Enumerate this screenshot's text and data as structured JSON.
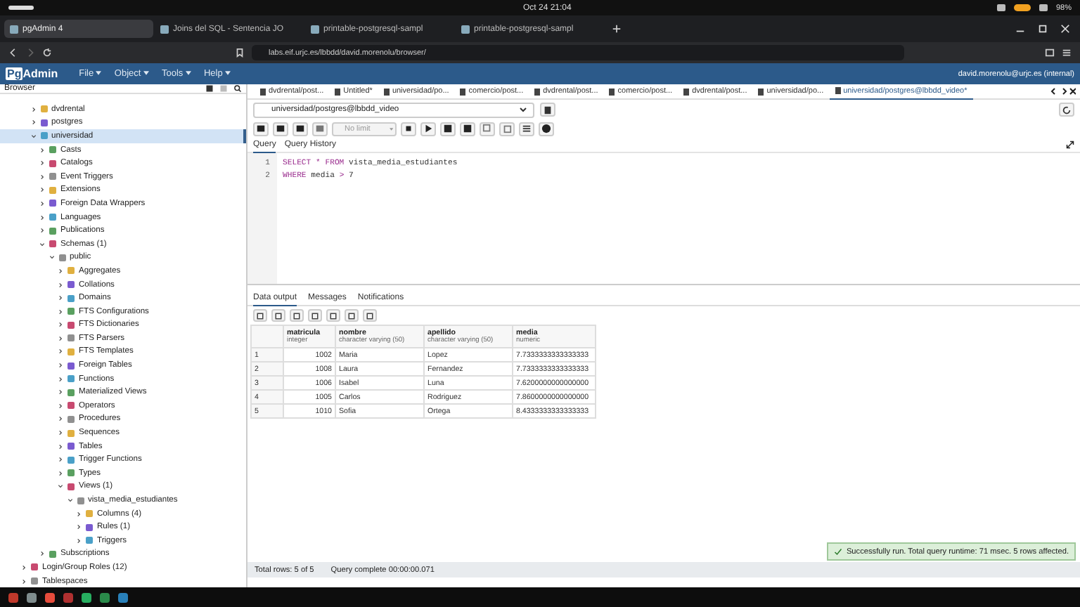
{
  "system_bar": {
    "date": "Oct 24",
    "time": "21:04",
    "battery": "98%"
  },
  "browser_tabs": [
    {
      "title": "pgAdmin 4",
      "selected": true
    },
    {
      "title": "Joins del SQL - Sentencia JO",
      "selected": false
    },
    {
      "title": "printable-postgresql-sampl",
      "selected": false
    },
    {
      "title": "printable-postgresql-sampl",
      "selected": false
    }
  ],
  "address_bar": {
    "url": "labs.eif.urjc.es/lbbdd/david.morenolu/browser/"
  },
  "pgadmin": {
    "logo_box": "Pg",
    "logo_text": "Admin",
    "menus": [
      "File",
      "Object",
      "Tools",
      "Help"
    ],
    "user": "david.morenolu@urjc.es (internal)"
  },
  "browser_panel": {
    "title": "Browser"
  },
  "tree": {
    "items": [
      {
        "children": [
          {
            "label": "dvdrental",
            "expanded": false,
            "selected": false
          },
          {
            "label": "postgres",
            "expanded": false,
            "selected": false
          },
          {
            "label": "universidad",
            "expanded": true,
            "selected": true,
            "children": [
              {
                "label": "Casts",
                "expanded": false,
                "selected": false
              },
              {
                "label": "Catalogs",
                "expanded": false,
                "selected": false
              },
              {
                "label": "Event Triggers",
                "expanded": false,
                "selected": false
              },
              {
                "label": "Extensions",
                "expanded": false,
                "selected": false
              },
              {
                "label": "Foreign Data Wrappers",
                "expanded": false,
                "selected": false
              },
              {
                "label": "Languages",
                "expanded": false,
                "selected": false
              },
              {
                "label": "Publications",
                "expanded": false,
                "selected": false
              },
              {
                "label": "Schemas (1)",
                "expanded": true,
                "selected": false,
                "children": [
                  {
                    "label": "public",
                    "expanded": true,
                    "selected": false,
                    "children": [
                      {
                        "label": "Aggregates",
                        "expanded": false,
                        "selected": false
                      },
                      {
                        "label": "Collations",
                        "expanded": false,
                        "selected": false
                      },
                      {
                        "label": "Domains",
                        "expanded": false,
                        "selected": false
                      },
                      {
                        "label": "FTS Configurations",
                        "expanded": false,
                        "selected": false
                      },
                      {
                        "label": "FTS Dictionaries",
                        "expanded": false,
                        "selected": false
                      },
                      {
                        "label": "FTS Parsers",
                        "expanded": false,
                        "selected": false
                      },
                      {
                        "label": "FTS Templates",
                        "expanded": false,
                        "selected": false
                      },
                      {
                        "label": "Foreign Tables",
                        "expanded": false,
                        "selected": false
                      },
                      {
                        "label": "Functions",
                        "expanded": false,
                        "selected": false
                      },
                      {
                        "label": "Materialized Views",
                        "expanded": false,
                        "selected": false
                      },
                      {
                        "label": "Operators",
                        "expanded": false,
                        "selected": false
                      },
                      {
                        "label": "Procedures",
                        "expanded": false,
                        "selected": false
                      },
                      {
                        "label": "Sequences",
                        "expanded": false,
                        "selected": false
                      },
                      {
                        "label": "Tables",
                        "expanded": false,
                        "selected": false
                      },
                      {
                        "label": "Trigger Functions",
                        "expanded": false,
                        "selected": false
                      },
                      {
                        "label": "Types",
                        "expanded": false,
                        "selected": false
                      },
                      {
                        "label": "Views (1)",
                        "expanded": true,
                        "selected": false,
                        "children": [
                          {
                            "label": "vista_media_estudiantes",
                            "expanded": true,
                            "selected": false,
                            "children": [
                              {
                                "label": "Columns (4)",
                                "expanded": false,
                                "selected": false
                              },
                              {
                                "label": "Rules (1)",
                                "expanded": false,
                                "selected": false
                              },
                              {
                                "label": "Triggers",
                                "expanded": false,
                                "selected": false
                              }
                            ]
                          }
                        ]
                      }
                    ]
                  }
                ]
              },
              {
                "label": "Subscriptions",
                "expanded": false,
                "selected": false
              }
            ]
          }
        ]
      },
      {
        "label": "Login/Group Roles (12)",
        "expanded": false,
        "selected": false
      },
      {
        "label": "Tablespaces",
        "expanded": false,
        "selected": false
      }
    ]
  },
  "query_tabs": [
    {
      "title": "dvdrental/post...",
      "selected": false
    },
    {
      "title": "Untitled*",
      "selected": false
    },
    {
      "title": "universidad/po...",
      "selected": false
    },
    {
      "title": "comercio/post...",
      "selected": false
    },
    {
      "title": "dvdrental/post...",
      "selected": false
    },
    {
      "title": "comercio/post...",
      "selected": false
    },
    {
      "title": "dvdrental/post...",
      "selected": false
    },
    {
      "title": "universidad/po...",
      "selected": false
    },
    {
      "title": "universidad/postgres@lbbdd_video*",
      "selected": true
    }
  ],
  "connection": "universidad/postgres@lbbdd_video",
  "toolbar": {
    "limit": "No limit"
  },
  "editor_tabs": [
    {
      "label": "Query",
      "selected": true
    },
    {
      "label": "Query History",
      "selected": false
    }
  ],
  "code": [
    {
      "number": "1",
      "tokens": [
        {
          "kind": "keyword",
          "text": "SELECT"
        },
        {
          "kind": "operator",
          "text": "*"
        },
        {
          "kind": "keyword",
          "text": "FROM"
        },
        {
          "kind": "text",
          "text": "vista_media_estudiantes"
        }
      ]
    },
    {
      "number": "2",
      "tokens": [
        {
          "kind": "keyword",
          "text": "WHERE"
        },
        {
          "kind": "text",
          "text": "media"
        },
        {
          "kind": "operator",
          "text": ">"
        },
        {
          "kind": "text",
          "text": "7"
        }
      ]
    }
  ],
  "result_tabs": [
    {
      "label": "Data output",
      "selected": true
    },
    {
      "label": "Messages",
      "selected": false
    },
    {
      "label": "Notifications",
      "selected": false
    }
  ],
  "table": {
    "columns": [
      {},
      {
        "name": "matricula",
        "type": "integer"
      },
      {
        "name": "nombre",
        "type": "character varying (50)"
      },
      {
        "name": "apellido",
        "type": "character varying (50)"
      },
      {
        "name": "media",
        "type": "numeric"
      }
    ],
    "rows": [
      [
        "1",
        "1002",
        "Maria",
        "Lopez",
        "7.7333333333333333"
      ],
      [
        "2",
        "1008",
        "Laura",
        "Fernandez",
        "7.7333333333333333"
      ],
      [
        "3",
        "1006",
        "Isabel",
        "Luna",
        "7.6200000000000000"
      ],
      [
        "4",
        "1005",
        "Carlos",
        "Rodriguez",
        "7.8600000000000000"
      ],
      [
        "5",
        "1010",
        "Sofia",
        "Ortega",
        "8.4333333333333333"
      ]
    ]
  },
  "status": {
    "rows": "Total rows: 5 of 5",
    "query": "Query complete 00:00:00.071"
  },
  "toast": "Successfully run. Total query runtime: 71 msec. 5 rows affected."
}
